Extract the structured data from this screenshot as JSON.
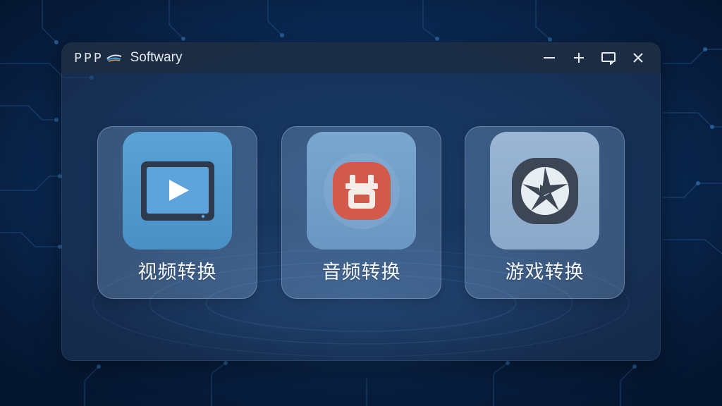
{
  "window": {
    "logo_text": "PPP",
    "title": "Softwary",
    "controls": {
      "minimize": "minimize-icon",
      "maximize": "plus-icon",
      "pin": "window-pin-icon",
      "close": "close-icon"
    }
  },
  "cards": [
    {
      "label": "视频转换",
      "icon": "tablet-play-icon",
      "accent": "#4a90c6"
    },
    {
      "label": "音频转换",
      "icon": "plug-icon",
      "accent": "#d35a4a"
    },
    {
      "label": "游戏转换",
      "icon": "aperture-play-icon",
      "accent": "#3d4654"
    }
  ],
  "colors": {
    "background": "#0b2f5e",
    "titlebar": "#1c2c42",
    "card": "#96b9e1",
    "label_text": "#f5f8fc"
  }
}
